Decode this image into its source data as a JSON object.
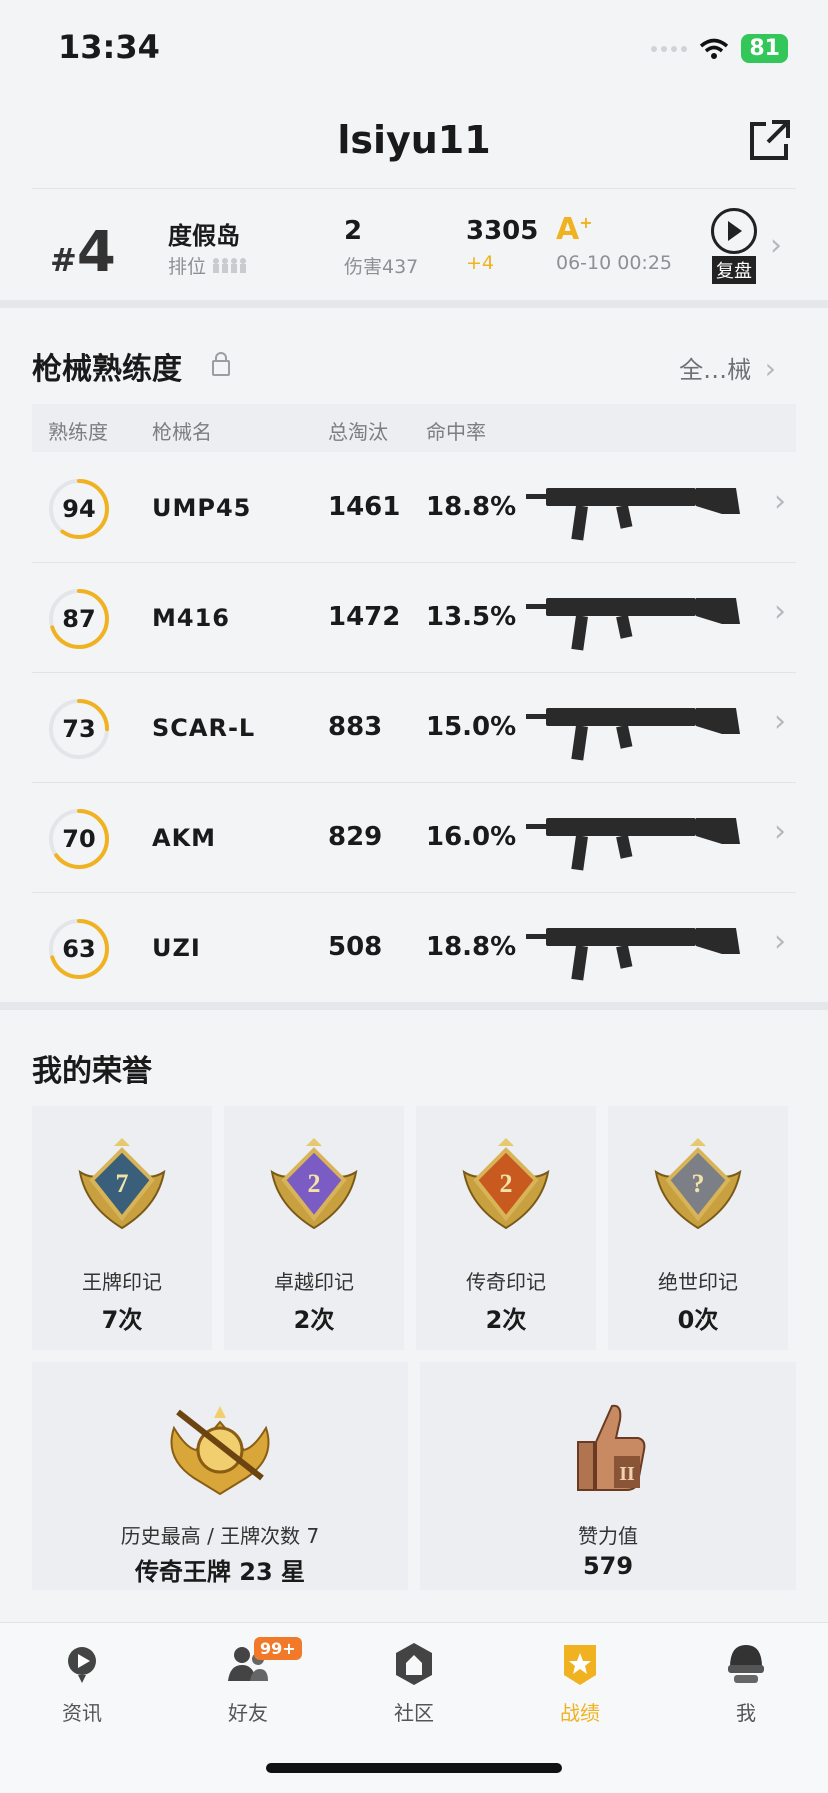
{
  "status": {
    "time": "13:34",
    "battery": "81"
  },
  "header": {
    "title": "lsiyu11"
  },
  "match": {
    "rank_hash": "#",
    "rank": "4",
    "map": "度假岛",
    "rank_label": "排位",
    "kills": "2",
    "damage": "伤害437",
    "score": "3305",
    "score_delta": "+4",
    "grade": "A",
    "grade_sup": "+",
    "time": "06-10 00:25",
    "replay_label": "复盘"
  },
  "weapons": {
    "title": "枪械熟练度",
    "all_link": "全…械",
    "headers": [
      "熟练度",
      "枪械名",
      "总淘汰",
      "命中率"
    ],
    "rows": [
      {
        "level": "94",
        "name": "UMP45",
        "kills": "1461",
        "accuracy": "18.8%",
        "progress": 0.6
      },
      {
        "level": "87",
        "name": "M416",
        "kills": "1472",
        "accuracy": "13.5%",
        "progress": 0.7
      },
      {
        "level": "73",
        "name": "SCAR-L",
        "kills": "883",
        "accuracy": "15.0%",
        "progress": 0.25
      },
      {
        "level": "70",
        "name": "AKM",
        "kills": "829",
        "accuracy": "16.0%",
        "progress": 0.65
      },
      {
        "level": "63",
        "name": "UZI",
        "kills": "508",
        "accuracy": "18.8%",
        "progress": 0.7
      }
    ]
  },
  "honors": {
    "title": "我的荣誉",
    "marks": [
      {
        "label": "王牌印记",
        "value": "7次",
        "badge_text": "7",
        "color": "#3a5f7a"
      },
      {
        "label": "卓越印记",
        "value": "2次",
        "badge_text": "2",
        "color": "#7a5cc4"
      },
      {
        "label": "传奇印记",
        "value": "2次",
        "badge_text": "2",
        "color": "#c85a1f"
      },
      {
        "label": "绝世印记",
        "value": "0次",
        "badge_text": "?",
        "color": "#7c7f86"
      }
    ],
    "highest": {
      "label": "历史最高 / 王牌次数 7",
      "value": "传奇王牌 23 星"
    },
    "likes": {
      "label": "赞力值",
      "value": "579"
    }
  },
  "tabs": [
    {
      "label": "资讯",
      "icon": "news-icon"
    },
    {
      "label": "好友",
      "icon": "friends-icon",
      "badge": "99+"
    },
    {
      "label": "社区",
      "icon": "community-icon"
    },
    {
      "label": "战绩",
      "icon": "record-icon",
      "active": true
    },
    {
      "label": "我",
      "icon": "profile-icon"
    }
  ],
  "colors": {
    "accent": "#f0b220",
    "battery": "#33c659"
  }
}
